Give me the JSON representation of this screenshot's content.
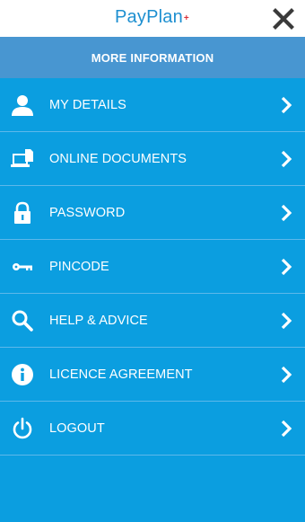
{
  "header": {
    "logo_text": "PayPlan",
    "logo_plus": "+",
    "close_icon": "close-icon"
  },
  "section": {
    "title": "MORE INFORMATION"
  },
  "menu": {
    "items": [
      {
        "label": "MY DETAILS",
        "icon": "user-icon"
      },
      {
        "label": "ONLINE DOCUMENTS",
        "icon": "laptop-document-icon"
      },
      {
        "label": "PASSWORD",
        "icon": "padlock-icon"
      },
      {
        "label": "PINCODE",
        "icon": "key-icon"
      },
      {
        "label": "HELP & ADVICE",
        "icon": "search-icon"
      },
      {
        "label": "LICENCE AGREEMENT",
        "icon": "info-icon"
      },
      {
        "label": "LOGOUT",
        "icon": "power-icon"
      }
    ]
  },
  "colors": {
    "background": "#0b9ee0",
    "section_header": "#4896d1",
    "logo": "#1d8fd0",
    "logo_plus": "#d9323b",
    "divider": "#5db8ea",
    "text": "#ffffff"
  }
}
